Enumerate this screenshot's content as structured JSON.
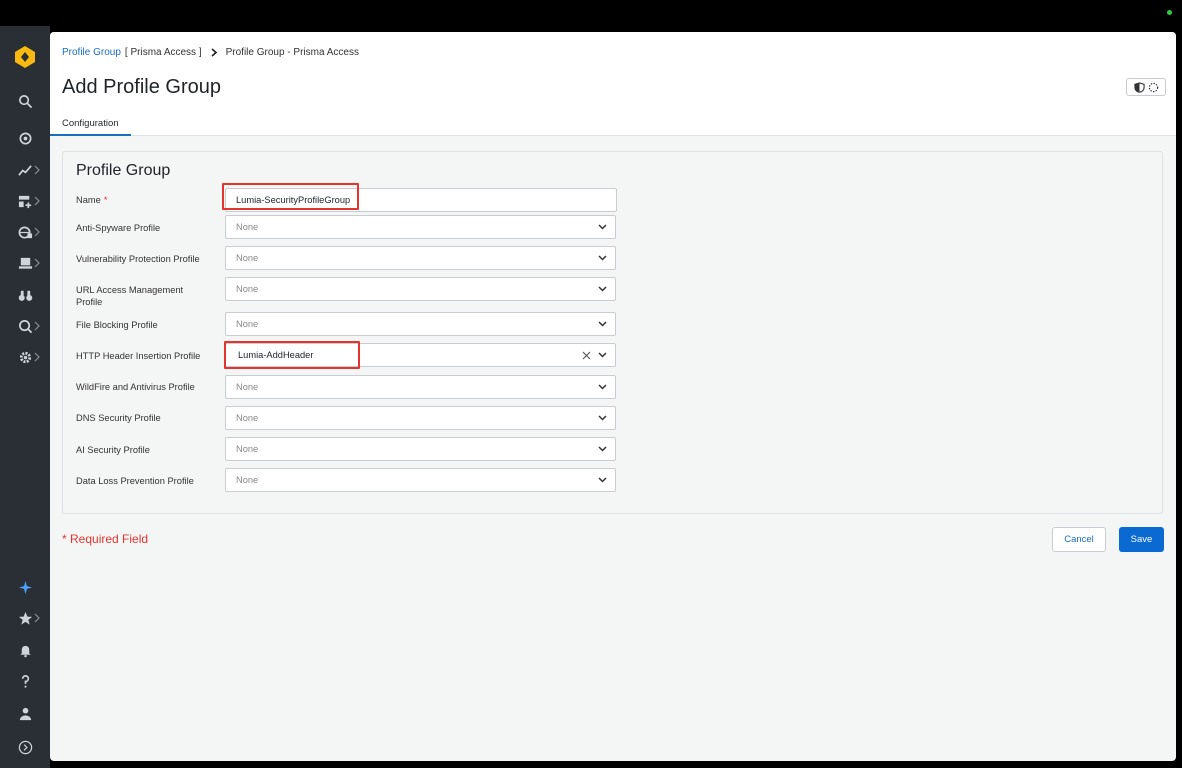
{
  "breadcrumb": {
    "link": "Profile Group",
    "context": "[ Prisma Access ]",
    "current": "Profile Group - Prisma Access"
  },
  "page": {
    "title": "Add Profile Group"
  },
  "tabs": [
    {
      "label": "Configuration"
    }
  ],
  "card": {
    "title": "Profile Group"
  },
  "form": {
    "name": {
      "label": "Name",
      "required_mark": "*",
      "value": "Lumia-SecurityProfileGroup"
    },
    "anti_spyware": {
      "label": "Anti-Spyware Profile",
      "value": "None"
    },
    "vulnerability": {
      "label": "Vulnerability Protection Profile",
      "value": "None"
    },
    "url_access": {
      "label": "URL Access Management Profile",
      "value": "None"
    },
    "file_blocking": {
      "label": "File Blocking Profile",
      "value": "None"
    },
    "http_header": {
      "label": "HTTP Header Insertion Profile",
      "value": "Lumia-AddHeader"
    },
    "wildfire": {
      "label": "WildFire and Antivirus Profile",
      "value": "None"
    },
    "dns_security": {
      "label": "DNS Security Profile",
      "value": "None"
    },
    "ai_security": {
      "label": "AI Security Profile",
      "value": "None"
    },
    "dlp": {
      "label": "Data Loss Prevention Profile",
      "value": "None"
    }
  },
  "footer": {
    "required_note": "Required Field",
    "required_mark": "*",
    "cancel_label": "Cancel",
    "save_label": "Save"
  },
  "sidebar": {
    "items": [
      {
        "icon": "search-icon"
      },
      {
        "icon": "dashboard-icon"
      },
      {
        "icon": "activity-icon"
      },
      {
        "icon": "add-widgets-icon"
      },
      {
        "icon": "network-globe-icon"
      },
      {
        "icon": "laptop-icon"
      },
      {
        "icon": "binoculars-icon"
      },
      {
        "icon": "investigate-icon"
      },
      {
        "icon": "gear-icon"
      },
      {
        "icon": "sparkle-icon"
      },
      {
        "icon": "star-icon"
      },
      {
        "icon": "bell-icon"
      },
      {
        "icon": "help-icon"
      },
      {
        "icon": "user-icon"
      },
      {
        "icon": "expand-icon"
      }
    ]
  },
  "colors": {
    "accent": "#0b6ad1",
    "link": "#1a6ebd",
    "error": "#e3342f",
    "sidebar": "#2a2f36"
  }
}
